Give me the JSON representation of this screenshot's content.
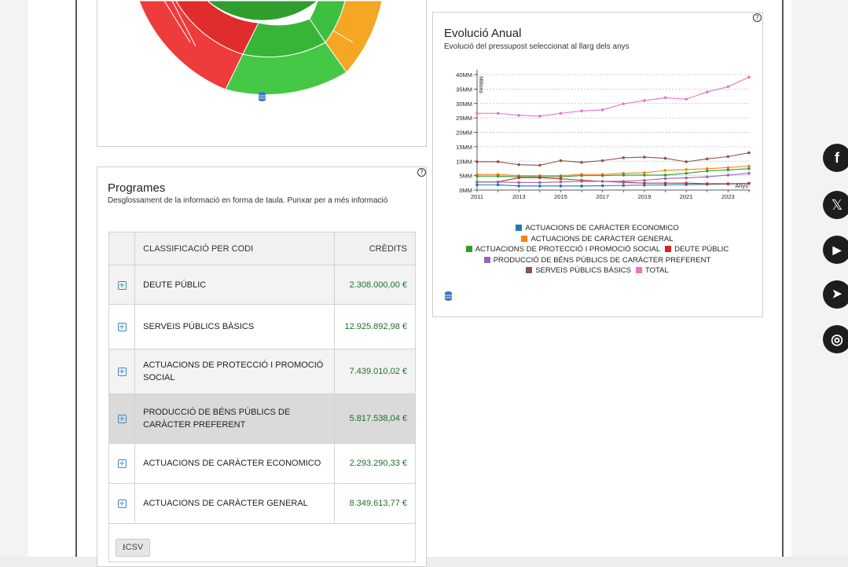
{
  "programes": {
    "title": "Programes",
    "subtitle": "Desglossament de la informació en forma de taula. Punxar per a més informació",
    "help": "?",
    "headers": {
      "code": "CLASSIFICACIÓ PER CODI",
      "credits": "CRÈDITS"
    },
    "rows": [
      {
        "name": "DEUTE PÚBLIC",
        "credit": "2.308.000,00 €"
      },
      {
        "name": "SERVEIS PÚBLICS BÀSICS",
        "credit": "12.925.892,98 €"
      },
      {
        "name": "ACTUACIONS DE PROTECCIÓ I PROMOCIÓ SOCIAL",
        "credit": "7.439.010,02 €"
      },
      {
        "name": "PRODUCCIÓ DE BÉNS PÚBLICS DE CARÀCTER PREFERENT",
        "credit": "5.817.538,04 €"
      },
      {
        "name": "ACTUACIONS DE CARÀCTER ECONOMICO",
        "credit": "2.293.290,33 €"
      },
      {
        "name": "ACTUACIONS DE CARÀCTER GENERAL",
        "credit": "8.349.613,77 €"
      }
    ],
    "csv_label": "CSV",
    "plus": "+"
  },
  "evolucio": {
    "title": "Evolució Anual",
    "subtitle": "Evolució del pressupost seleccionat al llarg dels anys",
    "help": "?"
  },
  "social": {
    "facebook": "f",
    "x": "𝕏",
    "youtube": "▶",
    "telegram": "➤",
    "instagram": "◎"
  },
  "icons": [
    "help-icon",
    "database-icon",
    "plus-square-icon",
    "download-icon",
    "facebook-icon",
    "x-icon",
    "youtube-icon",
    "telegram-icon",
    "instagram-icon"
  ],
  "chart_data": {
    "type": "line",
    "title": "Evolució Anual",
    "subtitle": "Evolució del pressupost seleccionat al llarg dels anys",
    "ylabel": "Milions",
    "xlabel": "Anys",
    "x": [
      2011,
      2012,
      2013,
      2014,
      2015,
      2016,
      2017,
      2018,
      2019,
      2020,
      2021,
      2022,
      2023,
      2024
    ],
    "x_ticks": [
      "2011",
      "2013",
      "2015",
      "2017",
      "2019",
      "2021",
      "2023"
    ],
    "y_ticks": [
      "0MM",
      "5MM",
      "10MM",
      "15MM",
      "20MM",
      "25MM",
      "30MM",
      "35MM",
      "40MM"
    ],
    "ylim": [
      0,
      40
    ],
    "grid": true,
    "legend": "bottom",
    "series": [
      {
        "name": "ACTUACIONS DE CARÀCTER ECONOMICO",
        "color": "#1f77b4",
        "values": [
          1.8,
          1.8,
          1.4,
          1.4,
          1.4,
          1.4,
          1.5,
          1.6,
          1.7,
          1.8,
          1.9,
          2.0,
          2.1,
          2.3
        ]
      },
      {
        "name": "ACTUACIONS DE CARÀCTER GENERAL",
        "color": "#ff7f0e",
        "values": [
          5.4,
          5.4,
          5.0,
          5.0,
          5.0,
          5.4,
          5.4,
          5.8,
          6.0,
          6.8,
          7.1,
          7.4,
          7.8,
          8.3
        ]
      },
      {
        "name": "ACTUACIONS DE PROTECCIÓ I PROMOCIÓ SOCIAL",
        "color": "#2ca02c",
        "values": [
          4.8,
          4.8,
          4.6,
          4.6,
          4.6,
          5.0,
          5.0,
          5.2,
          5.2,
          5.2,
          5.8,
          6.6,
          7.0,
          7.4
        ]
      },
      {
        "name": "DEUTE PÚBLIC",
        "color": "#d62728",
        "values": [
          2.8,
          2.8,
          4.3,
          4.3,
          3.9,
          3.4,
          3.0,
          2.7,
          2.4,
          2.4,
          2.4,
          2.2,
          2.2,
          2.3
        ]
      },
      {
        "name": "PRODUCCIÓ DE BÉNS PÚBLICS DE CARÀCTER PREFERENT",
        "color": "#9467bd",
        "values": [
          2.8,
          2.8,
          2.6,
          2.6,
          2.8,
          3.0,
          3.0,
          3.0,
          3.4,
          4.0,
          4.2,
          4.6,
          5.2,
          5.8
        ]
      },
      {
        "name": "SERVEIS PÚBLICS BÀSICS",
        "color": "#8c564b",
        "values": [
          9.8,
          9.8,
          8.8,
          8.6,
          10.2,
          9.6,
          10.2,
          11.2,
          11.4,
          11.0,
          9.8,
          10.8,
          11.6,
          12.9
        ]
      },
      {
        "name": "TOTAL",
        "color": "#e377c2",
        "values": [
          26.6,
          26.6,
          25.9,
          25.6,
          26.6,
          27.4,
          27.8,
          29.9,
          31.0,
          32.0,
          31.5,
          34.0,
          35.8,
          39.1
        ]
      }
    ]
  }
}
